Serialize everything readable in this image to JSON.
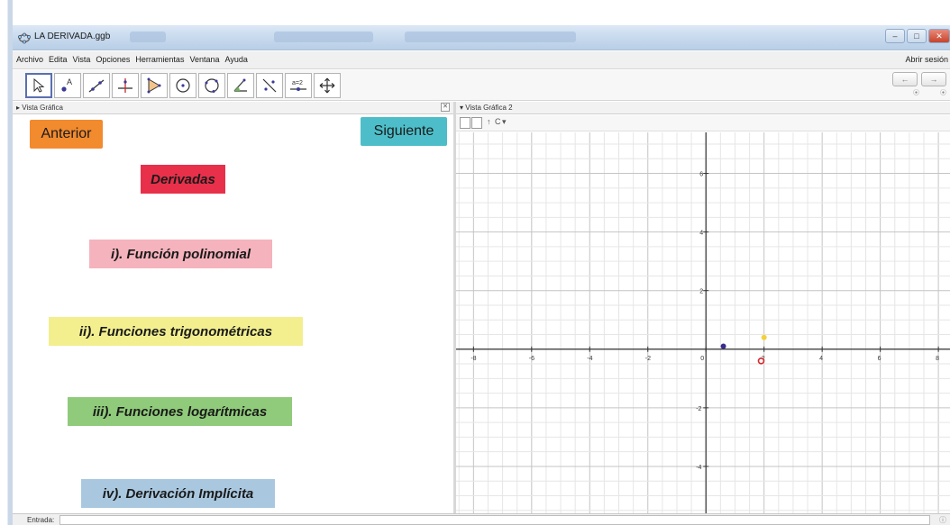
{
  "window": {
    "title": "LA DERIVADA.ggb",
    "minimize": "–",
    "maximize": "□",
    "close": "✕"
  },
  "menubar": {
    "items": [
      "Archivo",
      "Edita",
      "Vista",
      "Opciones",
      "Herramientas",
      "Ventana",
      "Ayuda"
    ],
    "sign_in": "Abrir sesión"
  },
  "toolbar": {
    "tools": [
      {
        "icon": "move-arrow-icon"
      },
      {
        "icon": "point-icon"
      },
      {
        "icon": "line-icon"
      },
      {
        "icon": "perpendicular-line-icon"
      },
      {
        "icon": "polygon-icon"
      },
      {
        "icon": "circle-center-icon"
      },
      {
        "icon": "circle-three-points-icon"
      },
      {
        "icon": "angle-icon"
      },
      {
        "icon": "reflect-icon"
      },
      {
        "icon": "slider-icon"
      },
      {
        "icon": "move-view-icon"
      }
    ],
    "slider_text": "a=2",
    "undo": "←",
    "redo": "→"
  },
  "view1": {
    "header_label": "Vista Gráfica",
    "header_close": "✕",
    "buttons": {
      "prev": "Anterior",
      "next": "Siguiente"
    },
    "items": [
      {
        "text": "Derivadas",
        "color": "#e8304a"
      },
      {
        "text": "i). Función polinomial",
        "color": "#f5b3bd"
      },
      {
        "text": "ii). Funciones trigonométricas",
        "color": "#f3ef8f"
      },
      {
        "text": "iii). Funciones logarítmicas",
        "color": "#8fcb7a"
      },
      {
        "text": "iv). Derivación Implícita",
        "color": "#a9c8e0"
      }
    ],
    "colors": {
      "prev_button": "#f28a2e",
      "next_button": "#4dbec9"
    }
  },
  "view2": {
    "header_label": "Vista Gráfica 2",
    "stylebar_glyphs": [
      "↑",
      "C",
      "▾"
    ]
  },
  "chart_data": {
    "type": "scatter",
    "xlim": [
      -8.6,
      8.4
    ],
    "ylim": [
      -5.6,
      7.4
    ],
    "grid": true,
    "x_ticks": [
      -8,
      -6,
      -4,
      -2,
      0,
      2,
      4,
      6,
      8
    ],
    "y_ticks": [
      -4,
      -2,
      2,
      4,
      6
    ],
    "points": [
      {
        "x": 0.6,
        "y": 0.1,
        "color": "#3a2a8c",
        "style": "filled"
      },
      {
        "x": 2.0,
        "y": 0.4,
        "color": "#f4d03f",
        "style": "filled"
      },
      {
        "x": 1.9,
        "y": -0.4,
        "color": "#d9262c",
        "style": "hollow"
      }
    ]
  },
  "inputbar": {
    "label": "Entrada:",
    "help": "ⓘ"
  }
}
